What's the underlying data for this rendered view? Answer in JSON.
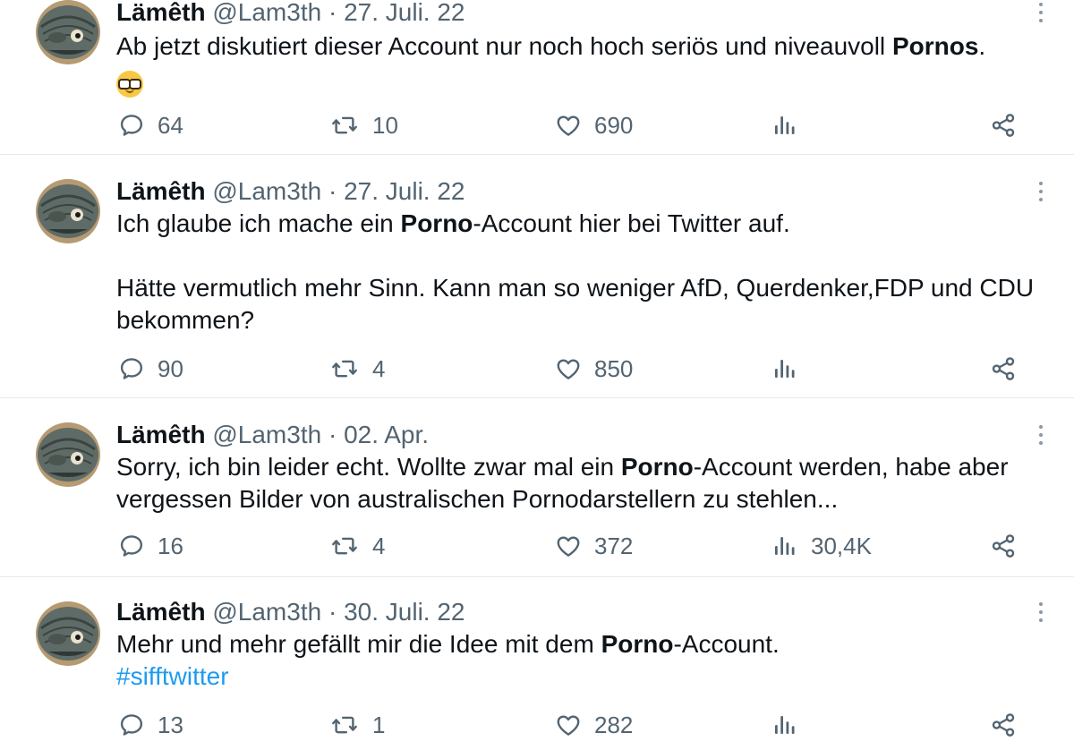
{
  "tweets": [
    {
      "author": {
        "name": "Lämêth",
        "handle": "@Lam3th"
      },
      "separator": "·",
      "date": "27. Juli. 22",
      "text_parts": [
        "Ab jetzt diskutiert dieser Account nur noch hoch seriös und niveauvoll ",
        "Pornos",
        "."
      ],
      "emoji": "nerd-face-emoji",
      "stats": {
        "replies": "64",
        "retweets": "10",
        "likes": "690",
        "views": ""
      }
    },
    {
      "author": {
        "name": "Lämêth",
        "handle": "@Lam3th"
      },
      "separator": "·",
      "date": "27. Juli. 22",
      "text_parts": [
        "Ich glaube ich mache ein ",
        "Porno",
        "-Account hier bei Twitter auf."
      ],
      "second_paragraph": "Hätte vermutlich mehr Sinn. Kann man so weniger AfD, Querdenker,FDP und CDU bekommen?",
      "stats": {
        "replies": "90",
        "retweets": "4",
        "likes": "850",
        "views": ""
      }
    },
    {
      "author": {
        "name": "Lämêth",
        "handle": "@Lam3th"
      },
      "separator": "·",
      "date": "02. Apr.",
      "text_parts": [
        "Sorry, ich bin leider echt. Wollte zwar mal ein ",
        "Porno",
        "-Account werden, habe aber vergessen Bilder von australischen Pornodarstellern zu stehlen..."
      ],
      "stats": {
        "replies": "16",
        "retweets": "4",
        "likes": "372",
        "views": "30,4K"
      }
    },
    {
      "author": {
        "name": "Lämêth",
        "handle": "@Lam3th"
      },
      "separator": "·",
      "date": "30. Juli. 22",
      "text_parts": [
        "Mehr und mehr gefällt mir die Idee mit dem ",
        "Porno",
        "-Account."
      ],
      "hashtag": "#sifftwitter",
      "stats": {
        "replies": "13",
        "retweets": "1",
        "likes": "282",
        "views": ""
      }
    }
  ],
  "icons": {
    "reply": "reply-icon",
    "retweet": "retweet-icon",
    "like": "heart-icon",
    "views": "views-icon",
    "share": "share-icon",
    "more": "more-icon"
  },
  "colors": {
    "text": "#0f1419",
    "secondary": "#536471",
    "hashtag": "#1d9bf0",
    "divider": "#e6e9ec"
  }
}
